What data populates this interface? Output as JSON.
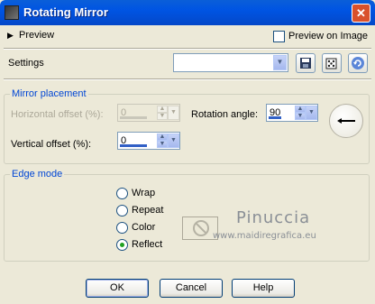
{
  "window": {
    "title": "Rotating Mirror"
  },
  "header": {
    "preview_label": "Preview",
    "preview_on_image_label": "Preview on Image",
    "preview_on_image_checked": false
  },
  "settings": {
    "label": "Settings",
    "preset_value": ""
  },
  "mirror_placement": {
    "title": "Mirror placement",
    "horizontal_offset": {
      "label": "Horizontal offset (%):",
      "value": "0",
      "enabled": false
    },
    "vertical_offset": {
      "label": "Vertical offset (%):",
      "value": "0",
      "enabled": true
    },
    "rotation_angle": {
      "label": "Rotation angle:",
      "value": "90"
    }
  },
  "edge_mode": {
    "title": "Edge mode",
    "options": [
      {
        "label": "Wrap",
        "selected": false
      },
      {
        "label": "Repeat",
        "selected": false
      },
      {
        "label": "Color",
        "selected": false
      },
      {
        "label": "Reflect",
        "selected": true
      }
    ]
  },
  "watermark": {
    "name": "Pinuccia",
    "site": "www.maidiregrafica.eu"
  },
  "buttons": {
    "ok": "OK",
    "cancel": "Cancel",
    "help": "Help"
  }
}
